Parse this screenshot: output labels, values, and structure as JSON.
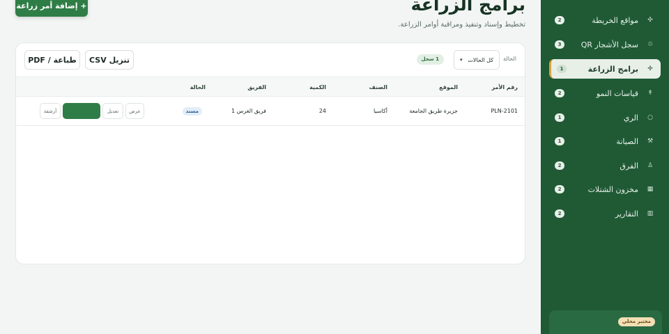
{
  "header": {
    "title": "برامج الزراعة",
    "subtitle": "تخطيط وإسناد وتنفيذ ومراقبة أوامر الزراعة.",
    "add_button": "+ إضافة أمر زراعة"
  },
  "toolbar": {
    "csv_button": "تنزيل CSV",
    "print_button": "طباعة / PDF",
    "filter_label": "الحالة",
    "status_select_value": "كل الحالات",
    "record_count": "1 سجل"
  },
  "table": {
    "columns": [
      "رقم الأمر",
      "الموقع",
      "الصنف",
      "الكمية",
      "الفريق",
      "الحالة"
    ],
    "rows": [
      {
        "order_no": "PLN-2101",
        "location": "جزيرة طريق الجامعة",
        "variety": "أكاسيا",
        "quantity": "24",
        "team": "فريق الغرس 1",
        "status": "مسند",
        "actions": {
          "view": "عرض",
          "edit": "تعديل",
          "archive": "أرشفة"
        }
      }
    ]
  },
  "sidebar": {
    "items": [
      {
        "label": "مواقع الخريطة",
        "icon": "✣",
        "badge": "2",
        "active": false
      },
      {
        "label": "سجل الأشجار QR",
        "icon": "♲",
        "badge": "3",
        "active": false
      },
      {
        "label": "برامج الزراعة",
        "icon": "✢",
        "badge": "1",
        "active": true
      },
      {
        "label": "قياسات النمو",
        "icon": "↟",
        "badge": "2",
        "active": false
      },
      {
        "label": "الري",
        "icon": "○",
        "badge": "1",
        "active": false
      },
      {
        "label": "الصيانة",
        "icon": "⚒",
        "badge": "1",
        "active": false
      },
      {
        "label": "الفرق",
        "icon": "♙",
        "badge": "2",
        "active": false
      },
      {
        "label": "مخزون الشتلات",
        "icon": "▦",
        "badge": "2",
        "active": false
      },
      {
        "label": "التقارير",
        "icon": "▥",
        "badge": "2",
        "active": false
      }
    ],
    "footer_badge": "مختبر محلي"
  },
  "colors": {
    "sidebar_bg": "#1f5a35",
    "primary_green": "#2f7d46",
    "active_accent": "#d9a441",
    "status_assigned": "#2b5f93"
  }
}
